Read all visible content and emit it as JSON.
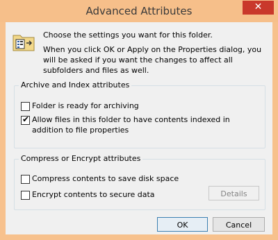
{
  "window": {
    "title": "Advanced Attributes",
    "close_label": "✕"
  },
  "intro": {
    "line1": "Choose the settings you want for this folder.",
    "line2": "When you click OK or Apply on the Properties dialog, you will be asked if you want the changes to affect all subfolders and files as well."
  },
  "archive_group": {
    "legend": "Archive and Index attributes",
    "archiving": {
      "label": "Folder is ready for archiving",
      "checked": false
    },
    "indexing": {
      "label": "Allow files in this folder to have contents indexed in addition to file properties",
      "checked": true
    }
  },
  "compress_group": {
    "legend": "Compress or Encrypt attributes",
    "compress": {
      "label": "Compress contents to save disk space",
      "checked": false
    },
    "encrypt": {
      "label": "Encrypt contents to secure data",
      "checked": false
    },
    "details_label": "Details"
  },
  "buttons": {
    "ok": "OK",
    "cancel": "Cancel"
  },
  "colors": {
    "frame": "#f7c18d",
    "close": "#c9382b",
    "client": "#f0f0f0"
  },
  "icons": {
    "folder": "folder-settings-icon",
    "check": "checkmark-icon"
  }
}
